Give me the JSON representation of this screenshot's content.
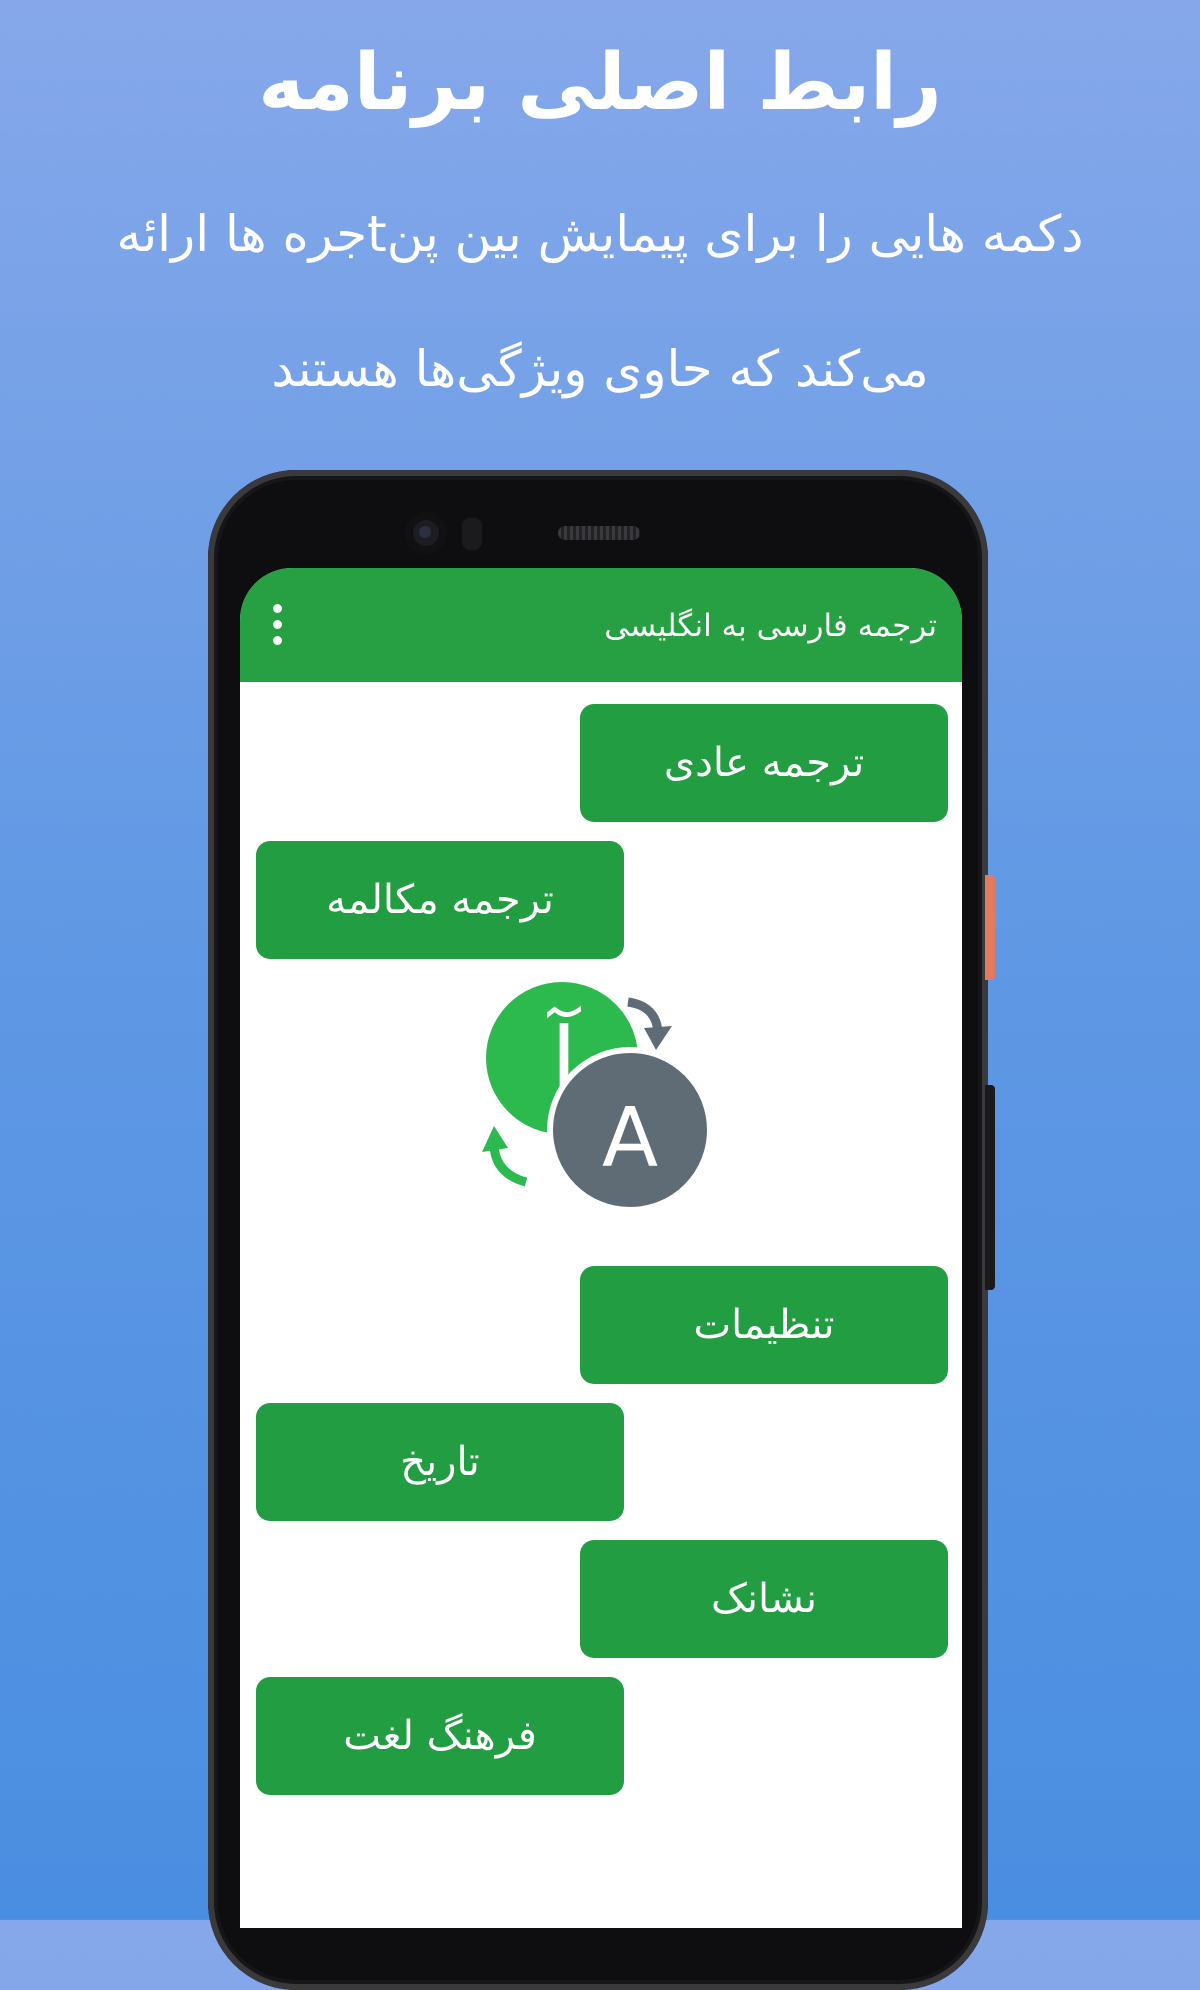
{
  "promo": {
    "title": "رابط اصلی برنامه",
    "subtitle_line1": "دکمه هایی را برای پیمایش بین پنtجره ها ارائه",
    "subtitle_line2": "می‌کند که حاوی ویژگی‌ها هستند"
  },
  "app": {
    "toolbar_title": "ترجمه فارسی به انگلیسی",
    "overflow_icon": "more-vert-icon",
    "logo_letters": {
      "persian": "آ",
      "english": "A"
    }
  },
  "buttons": [
    {
      "label": "ترجمه عادی"
    },
    {
      "label": "ترجمه مکالمه"
    },
    {
      "label": "تنظیمات"
    },
    {
      "label": "تاریخ"
    },
    {
      "label": "نشانک"
    },
    {
      "label": "فرهنگ لغت"
    }
  ],
  "colors": {
    "background_top": "#86a8ea",
    "background_bottom": "#4a8ee1",
    "accent_green": "#26a042",
    "logo_gray": "#5f6b75"
  }
}
